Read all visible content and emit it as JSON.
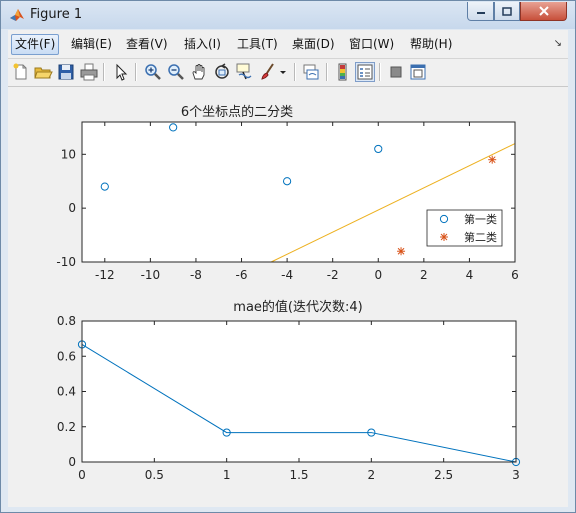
{
  "window": {
    "title": "Figure 1"
  },
  "menu": [
    "文件(F)",
    "编辑(E)",
    "查看(V)",
    "插入(I)",
    "工具(T)",
    "桌面(D)",
    "窗口(W)",
    "帮助(H)"
  ],
  "toolbar_icons": [
    "new-figure-icon",
    "open-file-icon",
    "save-icon",
    "print-icon",
    "edit-plot-arrow-icon",
    "zoom-in-icon",
    "zoom-out-icon",
    "pan-hand-icon",
    "rotate-3d-icon",
    "data-cursor-icon",
    "brush-icon",
    "brush-dropdown-icon",
    "link-plot-icon",
    "colorbar-icon",
    "legend-icon",
    "hide-plot-tools-icon",
    "show-plot-tools-icon"
  ],
  "colors": {
    "series_blue": "#0072BD",
    "series_red": "#D95319",
    "line_orange": "#EDB120"
  },
  "chart_data": [
    {
      "type": "scatter",
      "title": "6个坐标点的二分类",
      "xlim": [
        -13,
        6
      ],
      "ylim": [
        -10,
        16
      ],
      "xticks": [
        -12,
        -10,
        -8,
        -6,
        -4,
        -2,
        0,
        2,
        4,
        6
      ],
      "yticks": [
        -10,
        0,
        10
      ],
      "series": [
        {
          "name": "第一类",
          "marker": "circle",
          "points": [
            [
              -12,
              4
            ],
            [
              -9,
              15
            ],
            [
              -4,
              5
            ],
            [
              0,
              11
            ]
          ]
        },
        {
          "name": "第二类",
          "marker": "star",
          "points": [
            [
              1,
              -8
            ],
            [
              5,
              9
            ]
          ]
        }
      ],
      "decision_line": {
        "points": [
          [
            -4.7,
            -10
          ],
          [
            6,
            12
          ]
        ]
      },
      "legend_position": "lower-right"
    },
    {
      "type": "line",
      "title": "mae的值(迭代次数:4)",
      "xlim": [
        0,
        3
      ],
      "ylim": [
        0,
        0.8
      ],
      "xticks": [
        0,
        0.5,
        1,
        1.5,
        2,
        2.5,
        3
      ],
      "yticks": [
        0,
        0.2,
        0.4,
        0.6,
        0.8
      ],
      "x": [
        0,
        1,
        2,
        3
      ],
      "y": [
        0.667,
        0.167,
        0.167,
        0
      ]
    }
  ]
}
